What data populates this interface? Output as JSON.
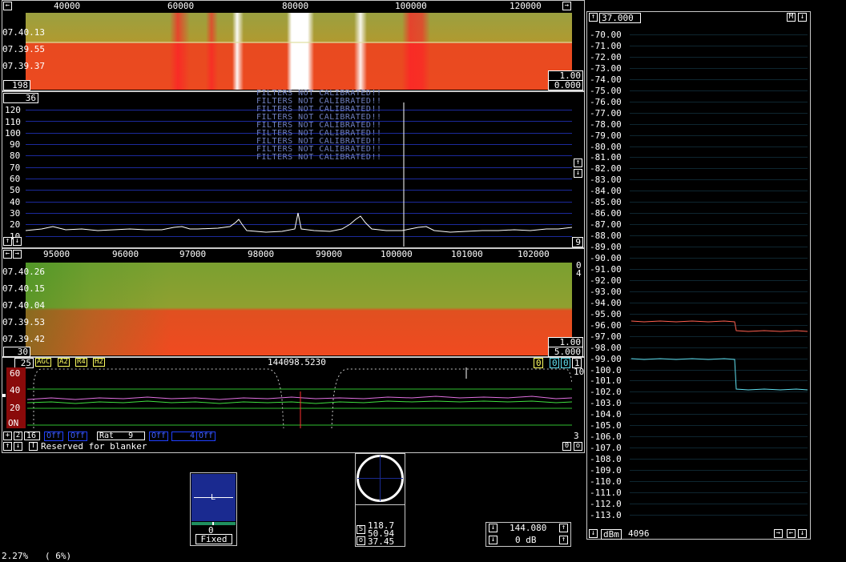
{
  "wf1": {
    "freq_ticks": [
      "40000",
      "60000",
      "80000",
      "100000",
      "120000"
    ],
    "time_labels": [
      "07.40.13",
      "07.39.55",
      "07.39.37"
    ],
    "left_value": "198",
    "gain": "1.00",
    "offset": "0.000"
  },
  "spec": {
    "top_value": "36",
    "bottom_value": "9",
    "y_ticks": [
      "120",
      "110",
      "100",
      "90",
      "80",
      "70",
      "60",
      "50",
      "40",
      "30",
      "20",
      "10"
    ],
    "warning": "FILTERS NOT CALIBRATED!!"
  },
  "wf2": {
    "freq_ticks": [
      "95000",
      "96000",
      "97000",
      "98000",
      "99000",
      "100000",
      "101000",
      "102000"
    ],
    "time_labels": [
      "07.40.26",
      "07.40.15",
      "07.40.04",
      "07.39.53",
      "07.39.42"
    ],
    "left_value": "30",
    "right_top": [
      "0",
      "4"
    ],
    "gain": "1.00",
    "offset": "5.000"
  },
  "hires": {
    "left_num": "25",
    "flags": [
      "AGC",
      "A2",
      "R4",
      "H2"
    ],
    "frequency": "144098.5230",
    "right_boxes": [
      "0",
      "0",
      "0",
      "1"
    ],
    "scale_right": "10",
    "y_ticks": [
      "60",
      "40",
      "20",
      "ON"
    ],
    "right_bottom": "3"
  },
  "controls": {
    "row1": [
      "+",
      "2",
      "16"
    ],
    "off_a": "Off",
    "off_b": "Off",
    "rat_label": "Rat",
    "rat_value": "9",
    "off_c": "Off",
    "n4": "4",
    "off_d": "Off",
    "row2_buttons": [
      "↑",
      "↓",
      "T"
    ],
    "status": "Reserved for blanker",
    "row2_right": [
      "0",
      "o"
    ]
  },
  "smeter": {
    "value": "0",
    "mode": "Fixed",
    "marker": "L"
  },
  "polar": {
    "s_label": "S",
    "o_label": "o",
    "values": [
      "118.7",
      "50.94",
      "37.45"
    ]
  },
  "tune": {
    "frequency": "144.080",
    "attenuation": "0 dB"
  },
  "level": {
    "top_value": "37.000",
    "m_button": "M",
    "y_ticks": [
      "-70.00",
      "-71.00",
      "-72.00",
      "-73.00",
      "-74.00",
      "-75.00",
      "-76.00",
      "-77.00",
      "-78.00",
      "-79.00",
      "-80.00",
      "-81.00",
      "-82.00",
      "-83.00",
      "-84.00",
      "-85.00",
      "-86.00",
      "-87.00",
      "-88.00",
      "-89.00",
      "-90.00",
      "-91.00",
      "-92.00",
      "-93.00",
      "-94.00",
      "-95.00",
      "-96.00",
      "-97.00",
      "-98.00",
      "-99.00",
      "-100.0",
      "-101.0",
      "-102.0",
      "-103.0",
      "-104.0",
      "-105.0",
      "-106.0",
      "-107.0",
      "-108.0",
      "-109.0",
      "-110.0",
      "-111.0",
      "-112.0",
      "-113.0"
    ],
    "unit": "dBm",
    "points": "4096"
  },
  "footer": {
    "cpu": "2.27%",
    "cpu2": "( 6%)"
  },
  "colors": {
    "grid": "#1c2a9c",
    "trace": "#ffffff",
    "trace_red": "#ff6050",
    "trace_cyan": "#60e0f0",
    "magenta": "#e070e0",
    "green_line": "#30c030"
  }
}
